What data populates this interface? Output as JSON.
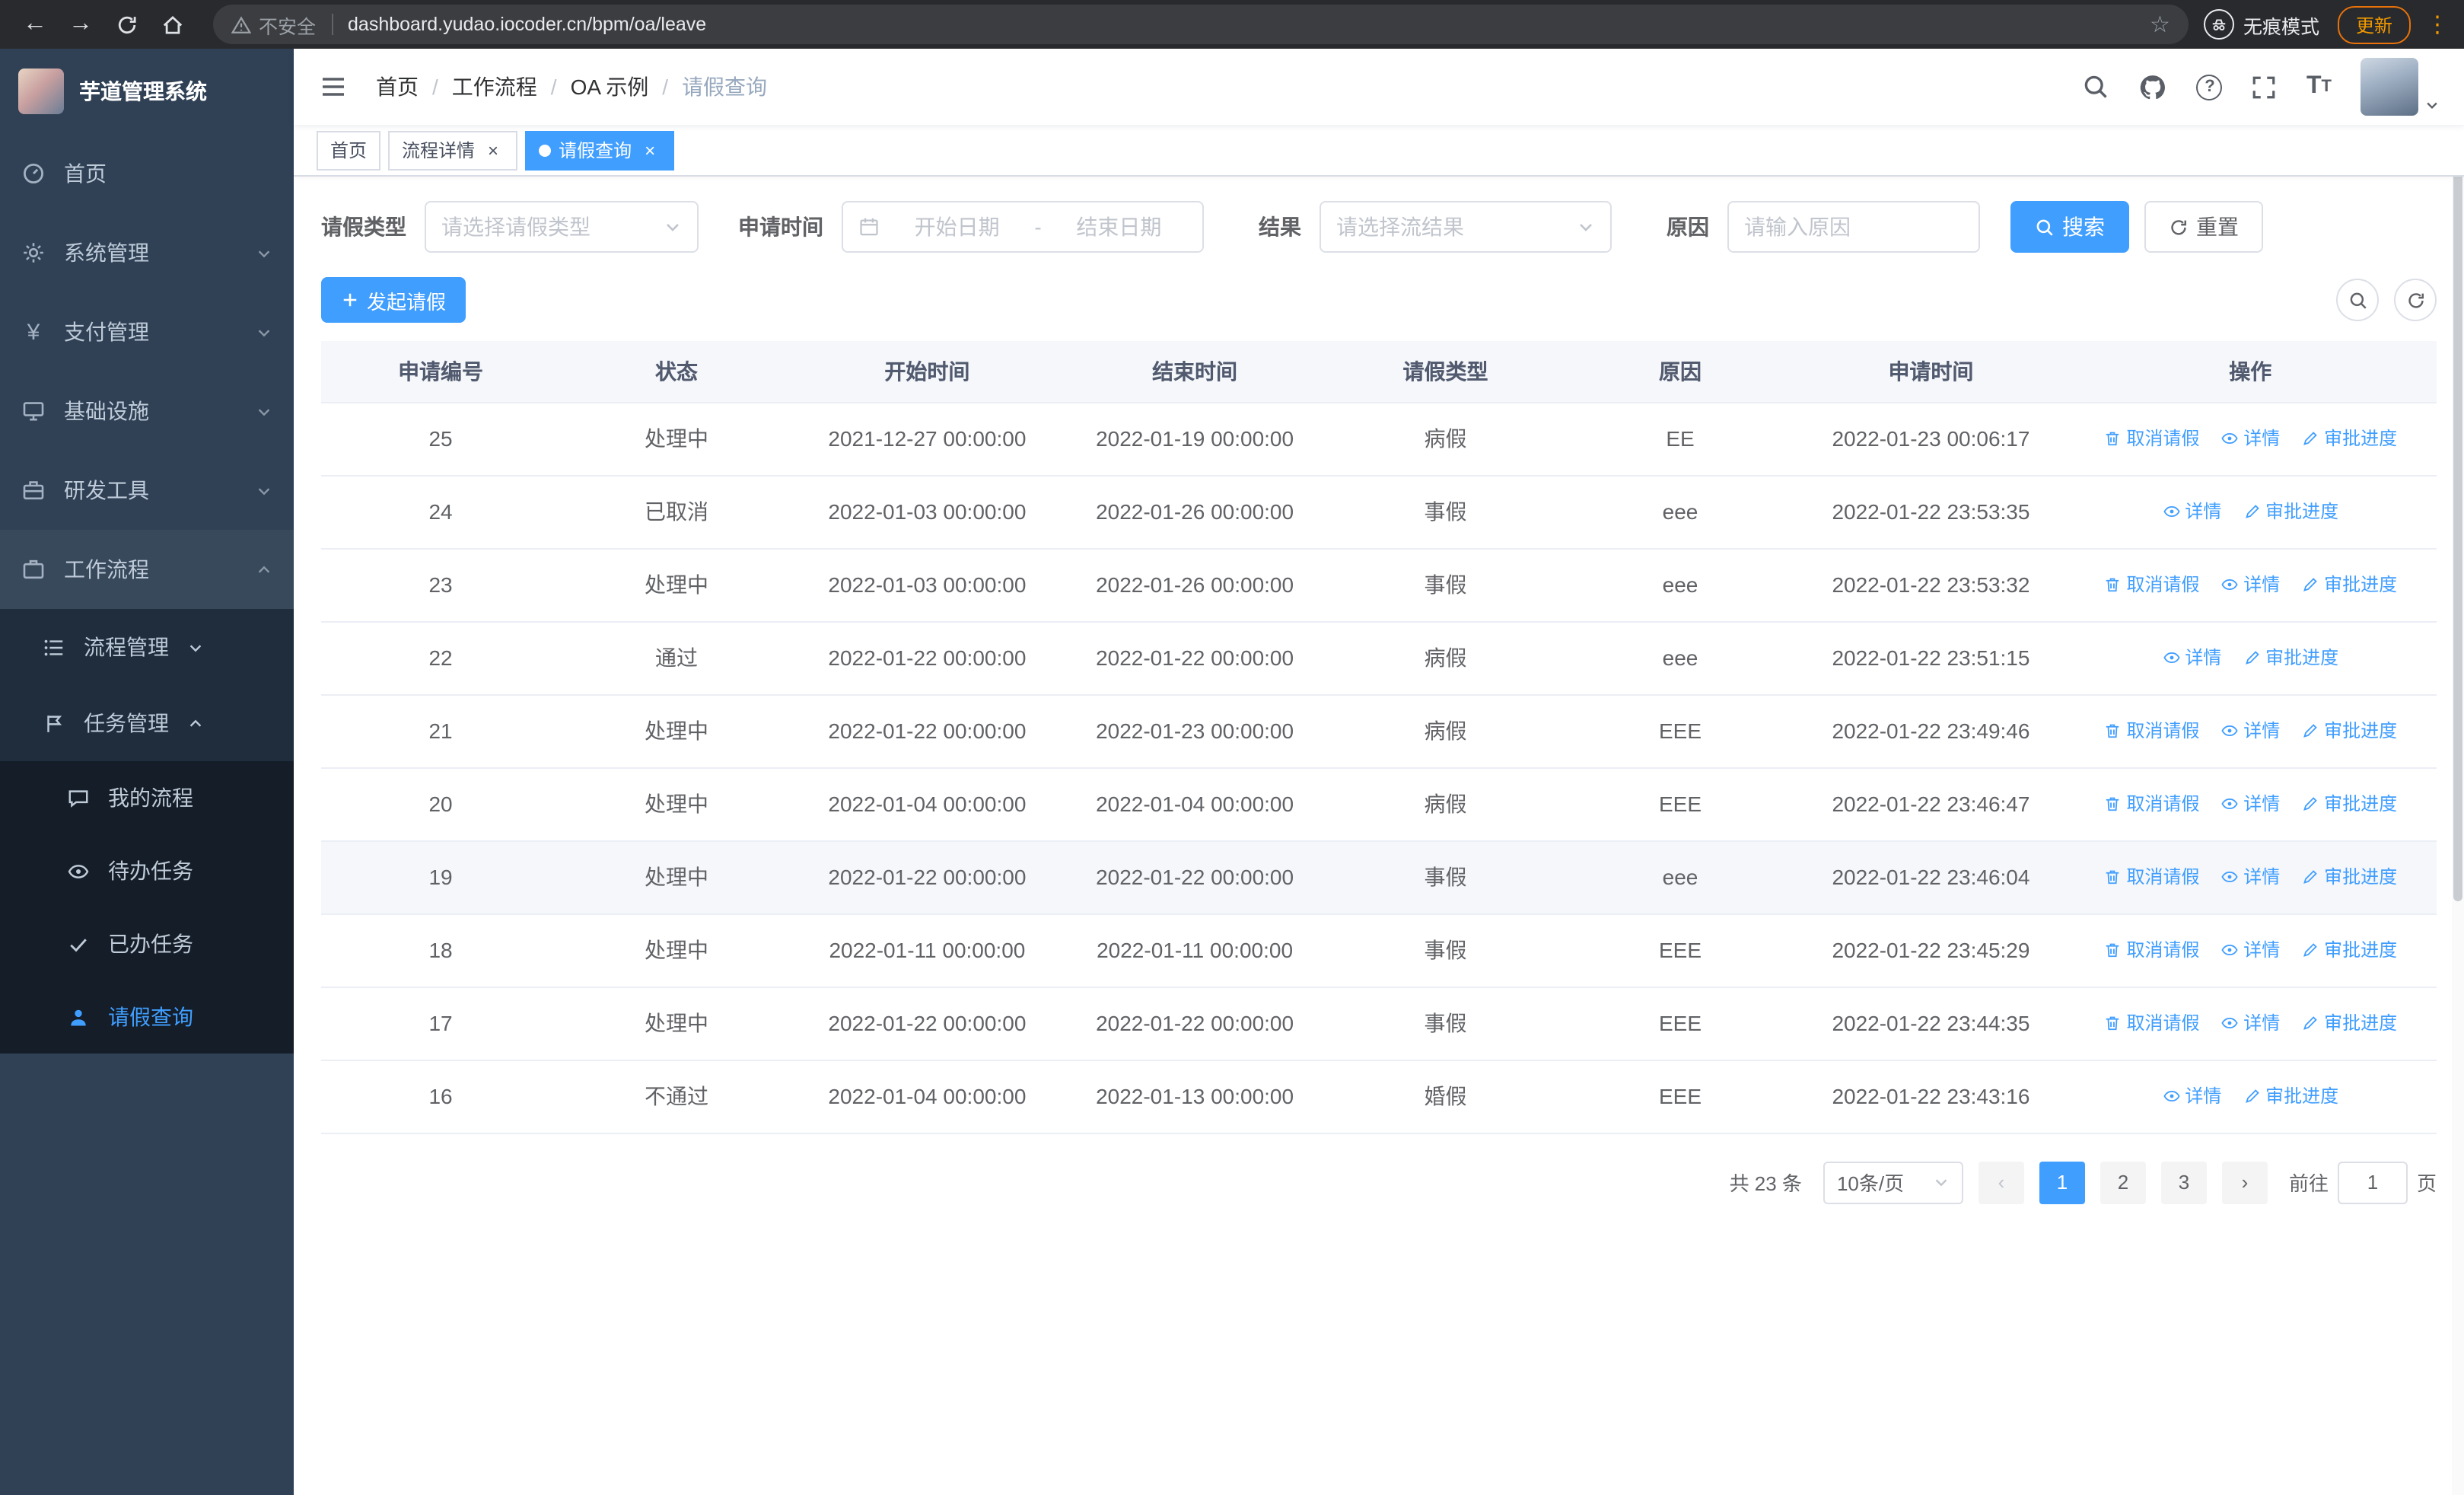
{
  "browser": {
    "security_label": "不安全",
    "url": "dashboard.yudao.iocoder.cn/bpm/oa/leave",
    "incognito_label": "无痕模式",
    "update_label": "更新"
  },
  "sidebar": {
    "title": "芋道管理系统",
    "menu": [
      {
        "label": "首页"
      },
      {
        "label": "系统管理"
      },
      {
        "label": "支付管理"
      },
      {
        "label": "基础设施"
      },
      {
        "label": "研发工具"
      },
      {
        "label": "工作流程"
      }
    ],
    "workflow_children": [
      {
        "label": "流程管理"
      },
      {
        "label": "任务管理"
      }
    ],
    "task_children": [
      {
        "label": "我的流程"
      },
      {
        "label": "待办任务"
      },
      {
        "label": "已办任务"
      },
      {
        "label": "请假查询"
      }
    ]
  },
  "navbar": {
    "breadcrumb": [
      {
        "label": "首页"
      },
      {
        "label": "工作流程"
      },
      {
        "label": "OA 示例"
      },
      {
        "label": "请假查询"
      }
    ]
  },
  "tabs": [
    {
      "label": "首页"
    },
    {
      "label": "流程详情"
    },
    {
      "label": "请假查询"
    }
  ],
  "filters": {
    "leave_type_label": "请假类型",
    "leave_type_placeholder": "请选择请假类型",
    "apply_time_label": "申请时间",
    "start_placeholder": "开始日期",
    "separator": "-",
    "end_placeholder": "结束日期",
    "result_label": "结果",
    "result_placeholder": "请选择流结果",
    "reason_label": "原因",
    "reason_placeholder": "请输入原因",
    "search_label": "搜索",
    "reset_label": "重置",
    "create_label": "发起请假"
  },
  "table": {
    "columns": [
      "申请编号",
      "状态",
      "开始时间",
      "结束时间",
      "请假类型",
      "原因",
      "申请时间",
      "操作"
    ],
    "action_labels": {
      "cancel": "取消请假",
      "detail": "详情",
      "progress": "审批进度"
    },
    "rows": [
      {
        "id": "25",
        "status": "处理中",
        "start": "2021-12-27 00:00:00",
        "end": "2022-01-19 00:00:00",
        "type": "病假",
        "reason": "EE",
        "applyTime": "2022-01-23 00:06:17",
        "cancel": true,
        "highlight": false
      },
      {
        "id": "24",
        "status": "已取消",
        "start": "2022-01-03 00:00:00",
        "end": "2022-01-26 00:00:00",
        "type": "事假",
        "reason": "eee",
        "applyTime": "2022-01-22 23:53:35",
        "cancel": false,
        "highlight": false
      },
      {
        "id": "23",
        "status": "处理中",
        "start": "2022-01-03 00:00:00",
        "end": "2022-01-26 00:00:00",
        "type": "事假",
        "reason": "eee",
        "applyTime": "2022-01-22 23:53:32",
        "cancel": true,
        "highlight": false
      },
      {
        "id": "22",
        "status": "通过",
        "start": "2022-01-22 00:00:00",
        "end": "2022-01-22 00:00:00",
        "type": "病假",
        "reason": "eee",
        "applyTime": "2022-01-22 23:51:15",
        "cancel": false,
        "highlight": false
      },
      {
        "id": "21",
        "status": "处理中",
        "start": "2022-01-22 00:00:00",
        "end": "2022-01-23 00:00:00",
        "type": "病假",
        "reason": "EEE",
        "applyTime": "2022-01-22 23:49:46",
        "cancel": true,
        "highlight": false
      },
      {
        "id": "20",
        "status": "处理中",
        "start": "2022-01-04 00:00:00",
        "end": "2022-01-04 00:00:00",
        "type": "病假",
        "reason": "EEE",
        "applyTime": "2022-01-22 23:46:47",
        "cancel": true,
        "highlight": false
      },
      {
        "id": "19",
        "status": "处理中",
        "start": "2022-01-22 00:00:00",
        "end": "2022-01-22 00:00:00",
        "type": "事假",
        "reason": "eee",
        "applyTime": "2022-01-22 23:46:04",
        "cancel": true,
        "highlight": true
      },
      {
        "id": "18",
        "status": "处理中",
        "start": "2022-01-11 00:00:00",
        "end": "2022-01-11 00:00:00",
        "type": "事假",
        "reason": "EEE",
        "applyTime": "2022-01-22 23:45:29",
        "cancel": true,
        "highlight": false
      },
      {
        "id": "17",
        "status": "处理中",
        "start": "2022-01-22 00:00:00",
        "end": "2022-01-22 00:00:00",
        "type": "事假",
        "reason": "EEE",
        "applyTime": "2022-01-22 23:44:35",
        "cancel": true,
        "highlight": false
      },
      {
        "id": "16",
        "status": "不通过",
        "start": "2022-01-04 00:00:00",
        "end": "2022-01-13 00:00:00",
        "type": "婚假",
        "reason": "EEE",
        "applyTime": "2022-01-22 23:43:16",
        "cancel": false,
        "highlight": false
      }
    ]
  },
  "pagination": {
    "total_label": "共 23 条",
    "page_size_label": "10条/页",
    "prev": "‹",
    "next": "›",
    "pages": [
      "1",
      "2",
      "3"
    ],
    "goto_label": "前往",
    "goto_value": "1",
    "page_suffix": "页"
  },
  "colors": {
    "accent": "#409eff",
    "sidebar": "#304156",
    "submenu": "#1f2d3d"
  }
}
